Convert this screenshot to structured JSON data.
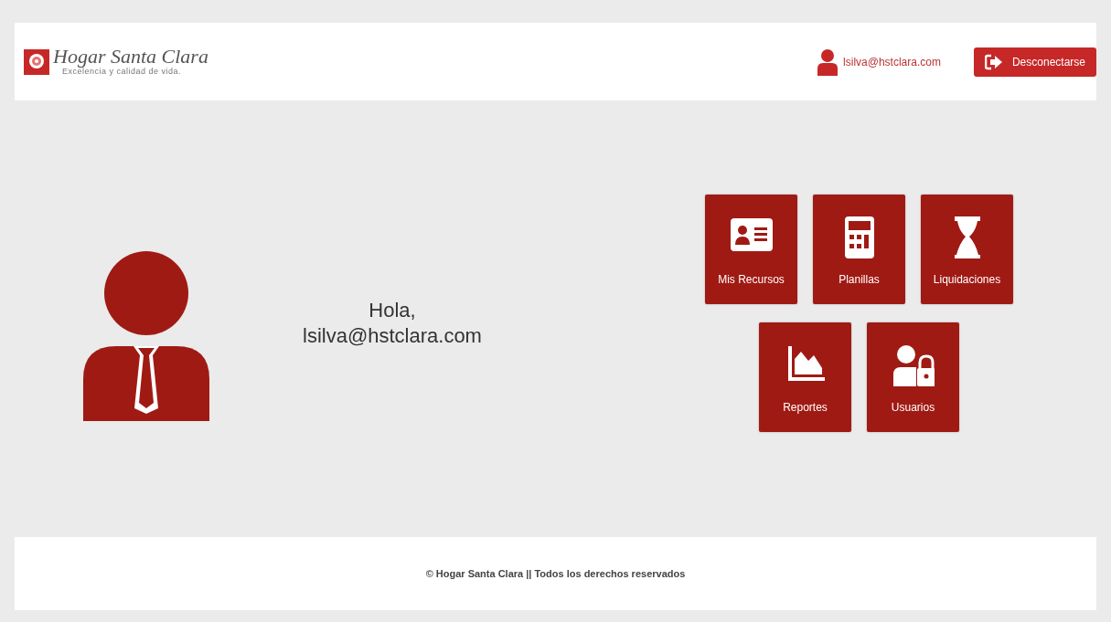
{
  "header": {
    "brand": "Hogar Santa Clara",
    "tagline": "Excelencia y calidad de vida.",
    "user": "lsilva@hstclara.com",
    "logout": "Desconectarse"
  },
  "greeting": {
    "line_1": "Hola,",
    "line_2": "lsilva@hstclara.com"
  },
  "tiles": [
    {
      "label": "Mis Recursos",
      "kind": "id-card"
    },
    {
      "label": "Planillas",
      "kind": "calculator"
    },
    {
      "label": "Liquidaciones",
      "kind": "hourglass"
    },
    {
      "label": "Reportes",
      "kind": "chart"
    },
    {
      "label": "Usuarios",
      "kind": "user-lock"
    }
  ],
  "footer": "© Hogar Santa Clara || Todos los derechos reservados"
}
